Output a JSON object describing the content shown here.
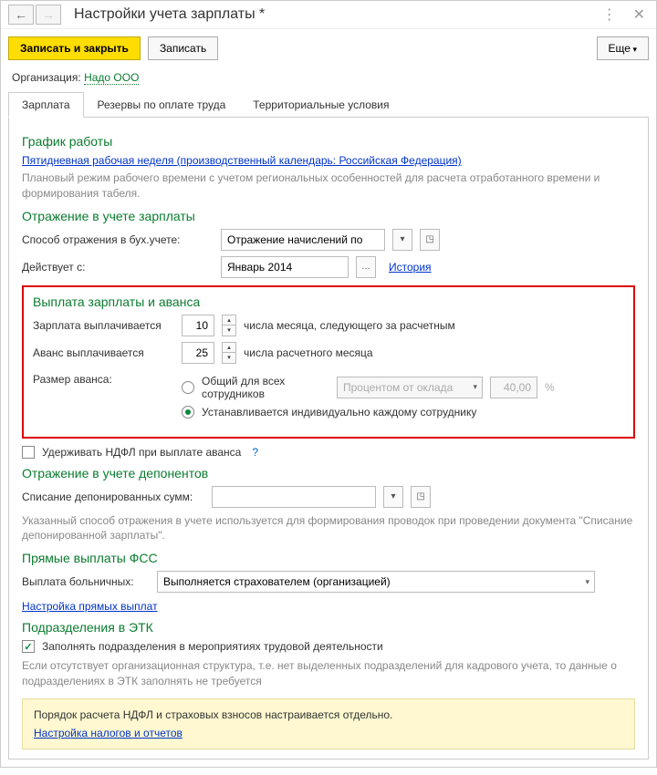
{
  "titlebar": {
    "title": "Настройки учета зарплаты *"
  },
  "toolbar": {
    "save_close": "Записать и закрыть",
    "save": "Записать",
    "more": "Еще"
  },
  "org": {
    "label": "Организация:",
    "value": "Надо ООО"
  },
  "tabs": {
    "t0": "Зарплата",
    "t1": "Резервы по оплате труда",
    "t2": "Территориальные условия"
  },
  "schedule": {
    "heading": "График работы",
    "link": "Пятидневная рабочая неделя (производственный календарь: Российская Федерация)",
    "hint": "Плановый режим рабочего времени с учетом региональных особенностей для расчета отработанного времени и формирования табеля."
  },
  "reflect": {
    "heading": "Отражение в учете зарплаты",
    "method_label": "Способ отражения в бух.учете:",
    "method_value": "Отражение начислений по",
    "effective_label": "Действует с:",
    "effective_value": "Январь 2014",
    "history": "История"
  },
  "payout": {
    "heading": "Выплата зарплаты и аванса",
    "salary_label": "Зарплата выплачивается",
    "salary_day": "10",
    "salary_suffix": "числа месяца, следующего за расчетным",
    "advance_label": "Аванс выплачивается",
    "advance_day": "25",
    "advance_suffix": "числа расчетного месяца",
    "size_label": "Размер аванса:",
    "opt_common": "Общий для всех сотрудников",
    "opt_individual": "Устанавливается индивидуально каждому сотруднику",
    "percent_mode": "Процентом от оклада",
    "percent_value": "40,00",
    "percent_suffix": "%"
  },
  "ndfl": {
    "label": "Удерживать НДФЛ при выплате аванса"
  },
  "deponents": {
    "heading": "Отражение в учете депонентов",
    "label": "Списание депонированных сумм:",
    "hint": "Указанный способ отражения в учете используется для формирования проводок при проведении документа \"Списание депонированной зарплаты\"."
  },
  "fss": {
    "heading": "Прямые выплаты ФСС",
    "label": "Выплата больничных:",
    "value": "Выполняется страхователем (организацией)",
    "link": "Настройка прямых выплат"
  },
  "etk": {
    "heading": "Подразделения в ЭТК",
    "check_label": "Заполнять подразделения в мероприятиях трудовой деятельности",
    "hint": "Если отсутствует организационная структура, т.е. нет выделенных подразделений для кадрового учета, то данные о подразделениях в ЭТК заполнять не требуется"
  },
  "yellow": {
    "text": "Порядок расчета НДФЛ и страховых взносов настраивается отдельно.",
    "link": "Настройка налогов и отчетов"
  }
}
